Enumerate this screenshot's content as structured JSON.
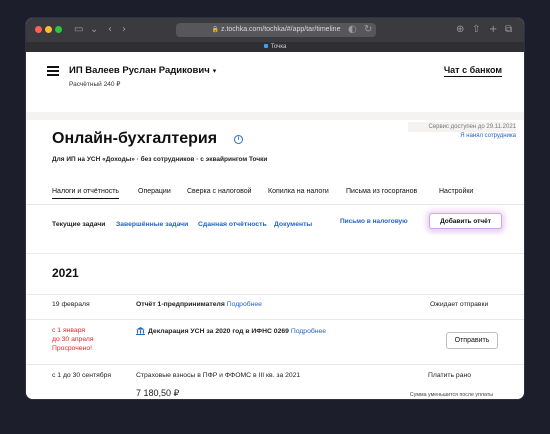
{
  "browser": {
    "url": "z.tochka.com/tochka/#/app/tar/timeline",
    "tab_label": "Точка"
  },
  "header": {
    "company": "ИП Валеев Руслан Радикович",
    "account": "Расчётный 240 ₽",
    "chat_link": "Чат с банком"
  },
  "service": {
    "available": "Сервис доступен до 29.11.2021",
    "new_employee": "Я нанял сотрудника"
  },
  "main": {
    "title": "Онлайн-бухгалтерия",
    "subtitle": "Для ИП на УСН «Доходы» · без сотрудников · с эквайрингом Точки",
    "tabs": [
      {
        "label": "Налоги и отчётность",
        "active": true
      },
      {
        "label": "Операции",
        "active": false
      },
      {
        "label": "Сверка с налоговой",
        "active": false
      },
      {
        "label": "Копилка на налоги",
        "active": false
      },
      {
        "label": "Письма из госорганов",
        "active": false
      },
      {
        "label": "Настройки",
        "active": false
      }
    ],
    "subtabs": [
      {
        "label": "Текущие задачи",
        "current": true
      },
      {
        "label": "Завершённые задачи",
        "current": false
      },
      {
        "label": "Сданная отчётность",
        "current": false
      },
      {
        "label": "Документы",
        "current": false
      }
    ],
    "mail_link": "Письмо в налоговую",
    "add_report_button": "Добавить отчёт",
    "year": "2021"
  },
  "tasks": [
    {
      "date": "19 февраля",
      "title": "Отчёт 1-предпринимателя",
      "more": "Подробнее",
      "status": "Ожидает отправки"
    },
    {
      "date_line1": "с 1 января",
      "date_line2": "до 30 апреля",
      "date_line3": "Просрочено!",
      "title": "Декларация УСН за 2020 год в ИФНС 0269",
      "more": "Подробнее",
      "button": "Отправить"
    },
    {
      "date": "с 1 до 30 сентября",
      "title": "Страховые взносы в ПФР и ФФОМС в III кв. за 2021",
      "amount": "7 180,50 ₽",
      "status": "Платить рано",
      "note": "Сумма уменьшится после уплаты взносов за предыдущий квартал"
    }
  ],
  "colors": {
    "link": "#2364c8",
    "overdue": "#e0262b",
    "accent_glow": "#caa6ea"
  }
}
